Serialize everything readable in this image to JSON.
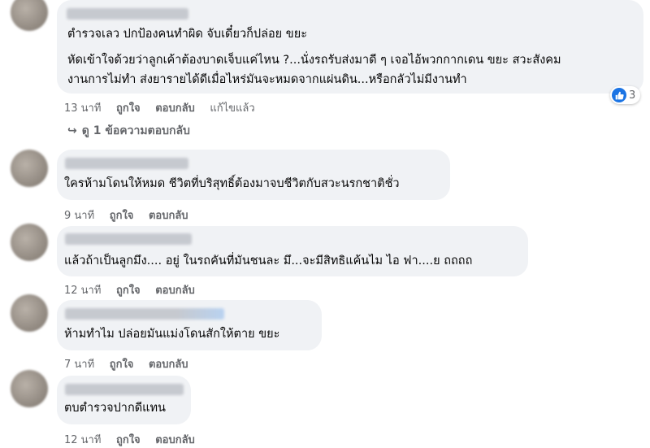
{
  "comments": [
    {
      "lines": [
        "ตำรวจเลว ปกป้องคนทำผิด จับเดี๋ยวก็ปล่อย ขยะ",
        "หัดเข้าใจด้วยว่าลูกเค้าต้องบาดเจ็บแค่ไหน ?...นั่งรถรับส่งมาดี ๆ เจอไอ้พวกกากเดน ขยะ สวะสังคม",
        "งานการไม่ทำ ส่งยารายได้ดีเมื่อไหร่มันจะหมดจากแผ่นดิน...หรือกลัวไม่มีงานทำ"
      ],
      "time": "13 นาที",
      "like": "ถูกใจ",
      "reply": "ตอบกลับ",
      "edited": "แก้ไขแล้ว",
      "reaction_count": "3",
      "view_replies": "ดู 1 ข้อความตอบกลับ"
    },
    {
      "lines": [
        "ใครห้ามโดนให้หมด ชีวิตที่บริสุทธิ์ต้องมาจบชีวิตกับสวะนรกชาติชั่ว"
      ],
      "time": "9 นาที",
      "like": "ถูกใจ",
      "reply": "ตอบกลับ"
    },
    {
      "lines": [
        "แล้วถ้าเป็นลูกมึง.... อยู่ ในรถคันที่มันชนละ มึ...จะมีสิทธิแค้นไม ไอ ฟา....ย ถถถถ"
      ],
      "time": "12 นาที",
      "like": "ถูกใจ",
      "reply": "ตอบกลับ"
    },
    {
      "lines": [
        "ห้ามทำไม ปล่อยมันแม่งโดนสักให้ตาย ขยะ"
      ],
      "time": "7 นาที",
      "like": "ถูกใจ",
      "reply": "ตอบกลับ"
    },
    {
      "lines": [
        "ตบตำรวจปากดีแทน"
      ],
      "time": "12 นาที",
      "like": "ถูกใจ",
      "reply": "ตอบกลับ"
    }
  ],
  "colors": {
    "bubble": "#f0f2f5",
    "meta": "#65676b",
    "like_blue": "#1b74e4"
  }
}
